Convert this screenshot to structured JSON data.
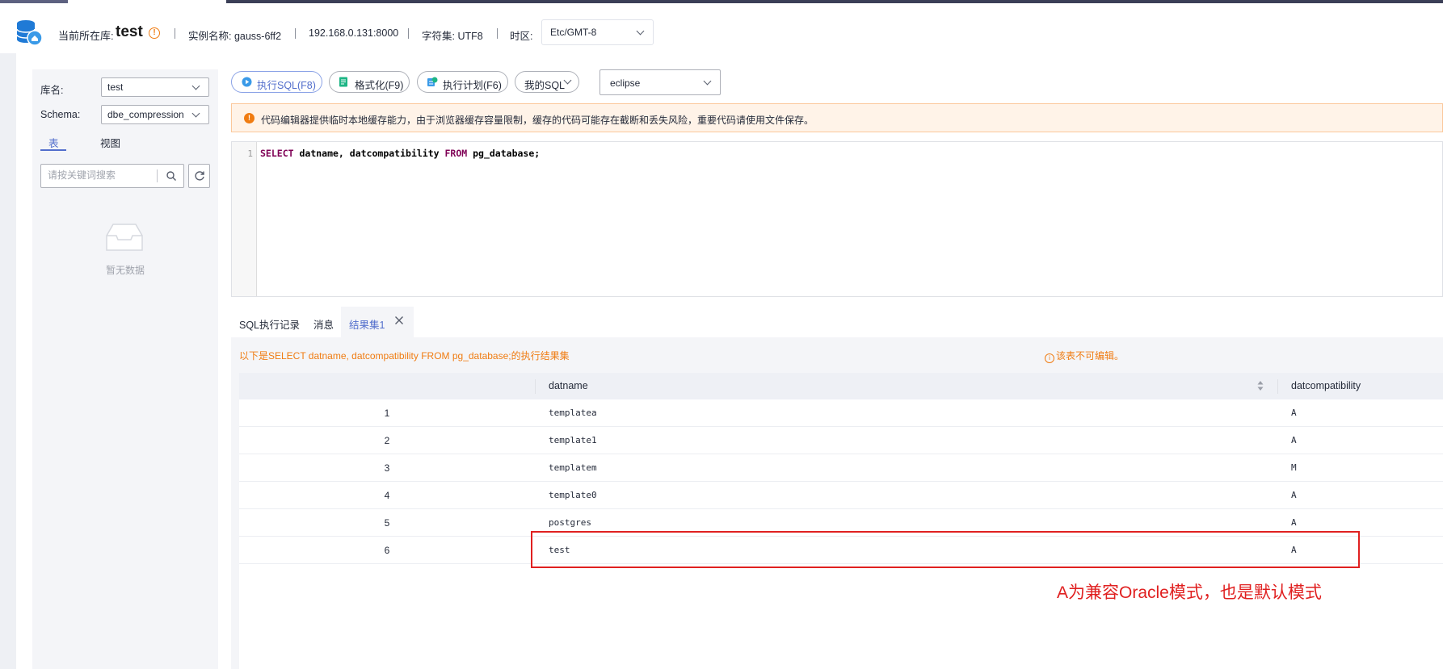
{
  "header": {
    "current_db_label": "当前所在库:",
    "current_db": "test",
    "instance": "实例名称: gauss-6ff2",
    "address": "192.168.0.131:8000",
    "charset": "字符集: UTF8",
    "timezone_label": "时区:",
    "timezone_value": "Etc/GMT-8"
  },
  "sidebar": {
    "db_label": "库名:",
    "db_value": "test",
    "schema_label": "Schema:",
    "schema_value": "dbe_compression",
    "tabs": [
      "表",
      "视图"
    ],
    "search_placeholder": "请按关键词搜索",
    "empty_text": "暂无数据"
  },
  "toolbar": {
    "run": "执行SQL(F8)",
    "format": "格式化(F9)",
    "plan": "执行计划(F6)",
    "my_sql": "我的SQL",
    "theme": "eclipse"
  },
  "warning": "代码编辑器提供临时本地缓存能力，由于浏览器缓存容量限制，缓存的代码可能存在截断和丢失风险，重要代码请使用文件保存。",
  "editor": {
    "line_number": "1",
    "kw_select": "SELECT",
    "cols": " datname, datcompatibility ",
    "kw_from": "FROM",
    "rest": " pg_database;"
  },
  "result_tabs": [
    "SQL执行记录",
    "消息",
    "结果集1"
  ],
  "result": {
    "info": "以下是SELECT datname, datcompatibility FROM pg_database;的执行结果集",
    "note": "该表不可编辑。",
    "columns": [
      "datname",
      "datcompatibility"
    ],
    "rows": [
      {
        "n": "1",
        "datname": "templatea",
        "datcompatibility": "A"
      },
      {
        "n": "2",
        "datname": "template1",
        "datcompatibility": "A"
      },
      {
        "n": "3",
        "datname": "templatem",
        "datcompatibility": "M"
      },
      {
        "n": "4",
        "datname": "template0",
        "datcompatibility": "A"
      },
      {
        "n": "5",
        "datname": "postgres",
        "datcompatibility": "A"
      },
      {
        "n": "6",
        "datname": "test",
        "datcompatibility": "A"
      }
    ]
  },
  "annotation": "A为兼容Oracle模式，也是默认模式",
  "colors": {
    "accent": "#526ecc",
    "warning": "#f07c12",
    "annotation": "#e02020"
  }
}
